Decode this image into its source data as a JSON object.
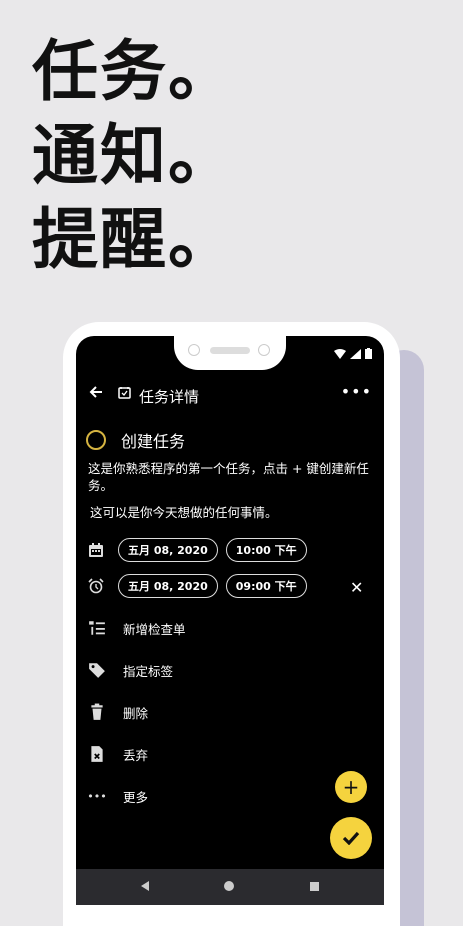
{
  "headline": {
    "line1": "任务。",
    "line2": "通知。",
    "line3": "提醒。"
  },
  "app": {
    "title": "任务详情",
    "task_title": "创建任务",
    "description": "这是你熟悉程序的第一个任务，点击 + 键创建新任务。",
    "description2": "这可以是你今天想做的任何事情。",
    "due": {
      "date": "五月 08, 2020",
      "time": "10:00 下午"
    },
    "reminder": {
      "date": "五月 08, 2020",
      "time": "09:00 下午"
    },
    "menu": [
      {
        "label": "新增检查单",
        "icon": "checklist-icon"
      },
      {
        "label": "指定标签",
        "icon": "tag-icon"
      },
      {
        "label": "删除",
        "icon": "trash-icon"
      },
      {
        "label": "丢弃",
        "icon": "discard-icon"
      },
      {
        "label": "更多",
        "icon": "more-icon"
      }
    ],
    "colors": {
      "accent": "#f5d33e",
      "circle": "#d6b441",
      "background": "#000000"
    }
  }
}
